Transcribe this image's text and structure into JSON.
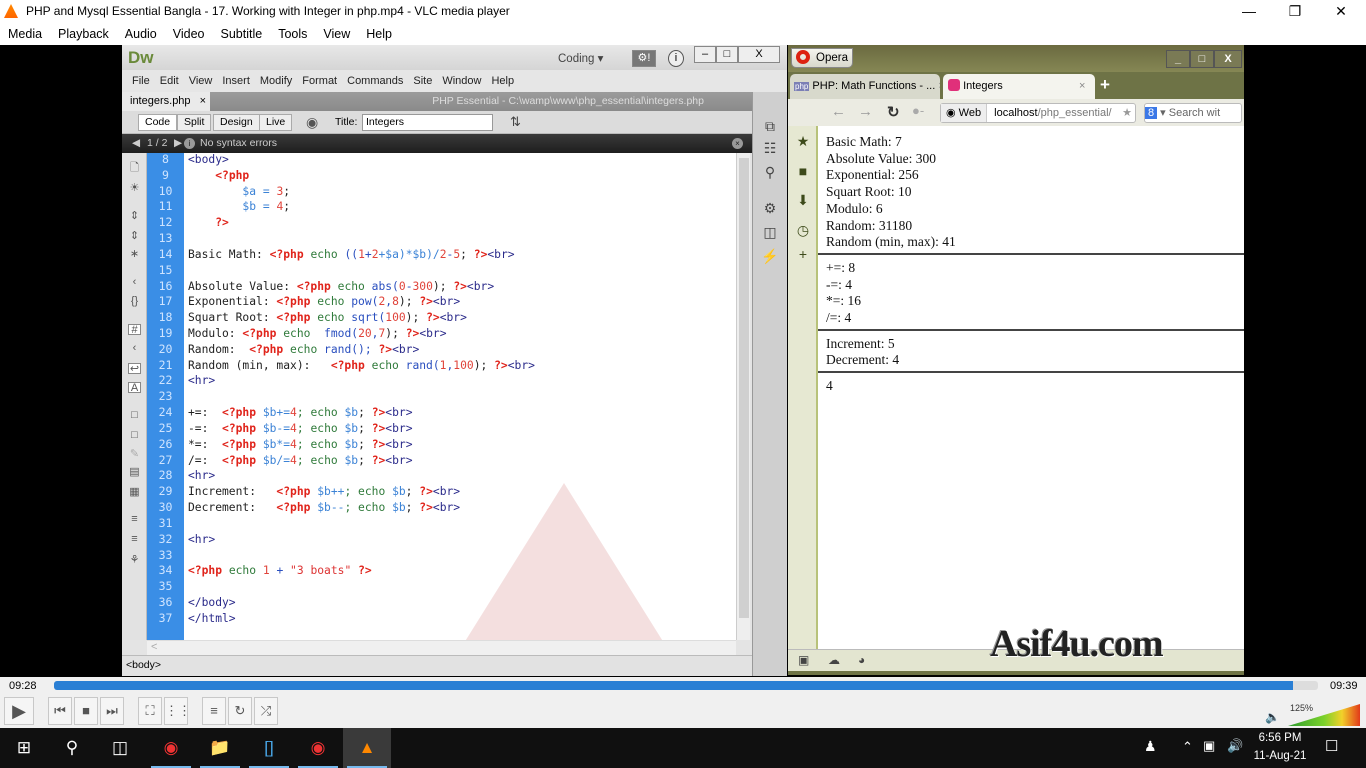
{
  "vlc": {
    "title": "PHP and Mysql Essential Bangla - 17. Working with Integer in php.mp4 - VLC media player",
    "menu": [
      "Media",
      "Playback",
      "Audio",
      "Video",
      "Subtitle",
      "Tools",
      "View",
      "Help"
    ],
    "elapsed": "09:28",
    "total": "09:39",
    "progress": 0.98,
    "volume": "125%",
    "volume_level": 1.25
  },
  "dw": {
    "logo": "Dw",
    "workspace": "Coding ▾",
    "menu": [
      "File",
      "Edit",
      "View",
      "Insert",
      "Modify",
      "Format",
      "Commands",
      "Site",
      "Window",
      "Help"
    ],
    "tab": "integers.php",
    "path": "PHP Essential - C:\\wamp\\www\\php_essential\\integers.php",
    "views": [
      "Code",
      "Split",
      "Design",
      "Live"
    ],
    "title_label": "Title:",
    "title_value": "Integers",
    "syntax_nav": "1 / 2",
    "syntax_msg": "No syntax errors",
    "status_tag": "<body>",
    "lines": [
      {
        "n": "8",
        "t": [
          [
            "<body>",
            "t"
          ]
        ]
      },
      {
        "n": "9",
        "t": [
          [
            "    ",
            "s"
          ],
          [
            "<?php",
            "p"
          ]
        ]
      },
      {
        "n": "10",
        "t": [
          [
            "        ",
            "s"
          ],
          [
            "$a",
            "v"
          ],
          [
            " = ",
            "v"
          ],
          [
            "3",
            "n"
          ],
          [
            ";",
            "s"
          ]
        ]
      },
      {
        "n": "11",
        "t": [
          [
            "        ",
            "s"
          ],
          [
            "$b",
            "v"
          ],
          [
            " = ",
            "v"
          ],
          [
            "4",
            "n"
          ],
          [
            ";",
            "s"
          ]
        ]
      },
      {
        "n": "12",
        "t": [
          [
            "    ",
            "s"
          ],
          [
            "?>",
            "p"
          ]
        ]
      },
      {
        "n": "13",
        "t": []
      },
      {
        "n": "14",
        "t": [
          [
            "Basic Math: ",
            "s"
          ],
          [
            "<?php",
            "p"
          ],
          [
            " echo ",
            "k"
          ],
          [
            "((",
            "f"
          ],
          [
            "1",
            "n"
          ],
          [
            "+",
            "f"
          ],
          [
            "2",
            "n"
          ],
          [
            "+$a)*$b)/",
            "v"
          ],
          [
            "2",
            "n"
          ],
          [
            "-",
            "f"
          ],
          [
            "5",
            "n"
          ],
          [
            "; ",
            "s"
          ],
          [
            "?>",
            "p"
          ],
          [
            "<br>",
            "t"
          ]
        ]
      },
      {
        "n": "15",
        "t": []
      },
      {
        "n": "16",
        "t": [
          [
            "Absolute Value: ",
            "s"
          ],
          [
            "<?php",
            "p"
          ],
          [
            " echo ",
            "k"
          ],
          [
            "abs(",
            "f"
          ],
          [
            "0",
            "n"
          ],
          [
            "-",
            "f"
          ],
          [
            "300",
            "n"
          ],
          [
            "); ",
            "s"
          ],
          [
            "?>",
            "p"
          ],
          [
            "<br>",
            "t"
          ]
        ]
      },
      {
        "n": "17",
        "t": [
          [
            "Exponential: ",
            "s"
          ],
          [
            "<?php",
            "p"
          ],
          [
            " echo ",
            "k"
          ],
          [
            "pow(",
            "f"
          ],
          [
            "2",
            "n"
          ],
          [
            ",",
            "f"
          ],
          [
            "8",
            "n"
          ],
          [
            "); ",
            "s"
          ],
          [
            "?>",
            "p"
          ],
          [
            "<br>",
            "t"
          ]
        ]
      },
      {
        "n": "18",
        "t": [
          [
            "Squart Root: ",
            "s"
          ],
          [
            "<?php",
            "p"
          ],
          [
            " echo ",
            "k"
          ],
          [
            "sqrt(",
            "f"
          ],
          [
            "100",
            "n"
          ],
          [
            "); ",
            "s"
          ],
          [
            "?>",
            "p"
          ],
          [
            "<br>",
            "t"
          ]
        ]
      },
      {
        "n": "19",
        "t": [
          [
            "Modulo: ",
            "s"
          ],
          [
            "<?php",
            "p"
          ],
          [
            " echo  ",
            "k"
          ],
          [
            "fmod(",
            "f"
          ],
          [
            "20",
            "n"
          ],
          [
            ",",
            "f"
          ],
          [
            "7",
            "n"
          ],
          [
            "); ",
            "s"
          ],
          [
            "?>",
            "p"
          ],
          [
            "<br>",
            "t"
          ]
        ]
      },
      {
        "n": "20",
        "t": [
          [
            "Random:  ",
            "s"
          ],
          [
            "<?php",
            "p"
          ],
          [
            " echo ",
            "k"
          ],
          [
            "rand(); ",
            "f"
          ],
          [
            "?>",
            "p"
          ],
          [
            "<br>",
            "t"
          ]
        ]
      },
      {
        "n": "21",
        "t": [
          [
            "Random (min, max):   ",
            "s"
          ],
          [
            "<?php",
            "p"
          ],
          [
            " echo ",
            "k"
          ],
          [
            "rand(",
            "f"
          ],
          [
            "1",
            "n"
          ],
          [
            ",",
            "f"
          ],
          [
            "100",
            "n"
          ],
          [
            "); ",
            "s"
          ],
          [
            "?>",
            "p"
          ],
          [
            "<br>",
            "t"
          ]
        ]
      },
      {
        "n": "22",
        "t": [
          [
            "<hr>",
            "t"
          ]
        ]
      },
      {
        "n": "23",
        "t": []
      },
      {
        "n": "24",
        "t": [
          [
            "+=:  ",
            "s"
          ],
          [
            "<?php",
            "p"
          ],
          [
            " $b+=",
            "v"
          ],
          [
            "4",
            "n"
          ],
          [
            "; echo ",
            "k"
          ],
          [
            "$b",
            "v"
          ],
          [
            "; ",
            "s"
          ],
          [
            "?>",
            "p"
          ],
          [
            "<br>",
            "t"
          ]
        ]
      },
      {
        "n": "25",
        "t": [
          [
            "-=:  ",
            "s"
          ],
          [
            "<?php",
            "p"
          ],
          [
            " $b-=",
            "v"
          ],
          [
            "4",
            "n"
          ],
          [
            "; echo ",
            "k"
          ],
          [
            "$b",
            "v"
          ],
          [
            "; ",
            "s"
          ],
          [
            "?>",
            "p"
          ],
          [
            "<br>",
            "t"
          ]
        ]
      },
      {
        "n": "26",
        "t": [
          [
            "*=:  ",
            "s"
          ],
          [
            "<?php",
            "p"
          ],
          [
            " $b*=",
            "v"
          ],
          [
            "4",
            "n"
          ],
          [
            "; echo ",
            "k"
          ],
          [
            "$b",
            "v"
          ],
          [
            "; ",
            "s"
          ],
          [
            "?>",
            "p"
          ],
          [
            "<br>",
            "t"
          ]
        ]
      },
      {
        "n": "27",
        "t": [
          [
            "/=:  ",
            "s"
          ],
          [
            "<?php",
            "p"
          ],
          [
            " $b/=",
            "v"
          ],
          [
            "4",
            "n"
          ],
          [
            "; echo ",
            "k"
          ],
          [
            "$b",
            "v"
          ],
          [
            "; ",
            "s"
          ],
          [
            "?>",
            "p"
          ],
          [
            "<br>",
            "t"
          ]
        ]
      },
      {
        "n": "28",
        "t": [
          [
            "<hr>",
            "t"
          ]
        ]
      },
      {
        "n": "29",
        "t": [
          [
            "Increment:   ",
            "s"
          ],
          [
            "<?php",
            "p"
          ],
          [
            " $b++",
            "v"
          ],
          [
            "; echo ",
            "k"
          ],
          [
            "$b",
            "v"
          ],
          [
            "; ",
            "s"
          ],
          [
            "?>",
            "p"
          ],
          [
            "<br>",
            "t"
          ]
        ]
      },
      {
        "n": "30",
        "t": [
          [
            "Decrement:   ",
            "s"
          ],
          [
            "<?php",
            "p"
          ],
          [
            " $b--",
            "v"
          ],
          [
            "; echo ",
            "k"
          ],
          [
            "$b",
            "v"
          ],
          [
            "; ",
            "s"
          ],
          [
            "?>",
            "p"
          ],
          [
            "<br>",
            "t"
          ]
        ]
      },
      {
        "n": "31",
        "t": []
      },
      {
        "n": "32",
        "t": [
          [
            "<hr>",
            "t"
          ]
        ]
      },
      {
        "n": "33",
        "t": []
      },
      {
        "n": "34",
        "t": [
          [
            "<?php",
            "p"
          ],
          [
            " echo ",
            "k"
          ],
          [
            "1",
            "n"
          ],
          [
            " + ",
            "f"
          ],
          [
            "\"3 boats\"",
            "q"
          ],
          [
            " ",
            "s"
          ],
          [
            "?>",
            "p"
          ]
        ]
      },
      {
        "n": "35",
        "t": []
      },
      {
        "n": "36",
        "t": [
          [
            "</body>",
            "t"
          ]
        ]
      },
      {
        "n": "37",
        "t": [
          [
            "</html>",
            "t"
          ]
        ]
      }
    ]
  },
  "opera": {
    "app": "Opera",
    "tabs": [
      {
        "label": "PHP: Math Functions - ...",
        "active": false
      },
      {
        "label": "Integers",
        "active": true
      }
    ],
    "web_label": "Web",
    "url_host": "localhost",
    "url_path": "/php_essential/",
    "search_placeholder": "Search wit",
    "output": {
      "group1": [
        "Basic Math: 7",
        "Absolute Value: 300",
        "Exponential: 256",
        "Squart Root: 10",
        "Modulo: 6",
        "Random: 31180",
        "Random (min, max): 41"
      ],
      "group2": [
        "+=: 8",
        "-=: 4",
        "*=: 16",
        "/=: 4"
      ],
      "group3": [
        "Increment: 5",
        "Decrement: 4"
      ],
      "group4": [
        "4"
      ]
    }
  },
  "watermark": "Asif4u.com",
  "taskbar": {
    "time": "6:56 PM",
    "date": "11-Aug-21"
  }
}
